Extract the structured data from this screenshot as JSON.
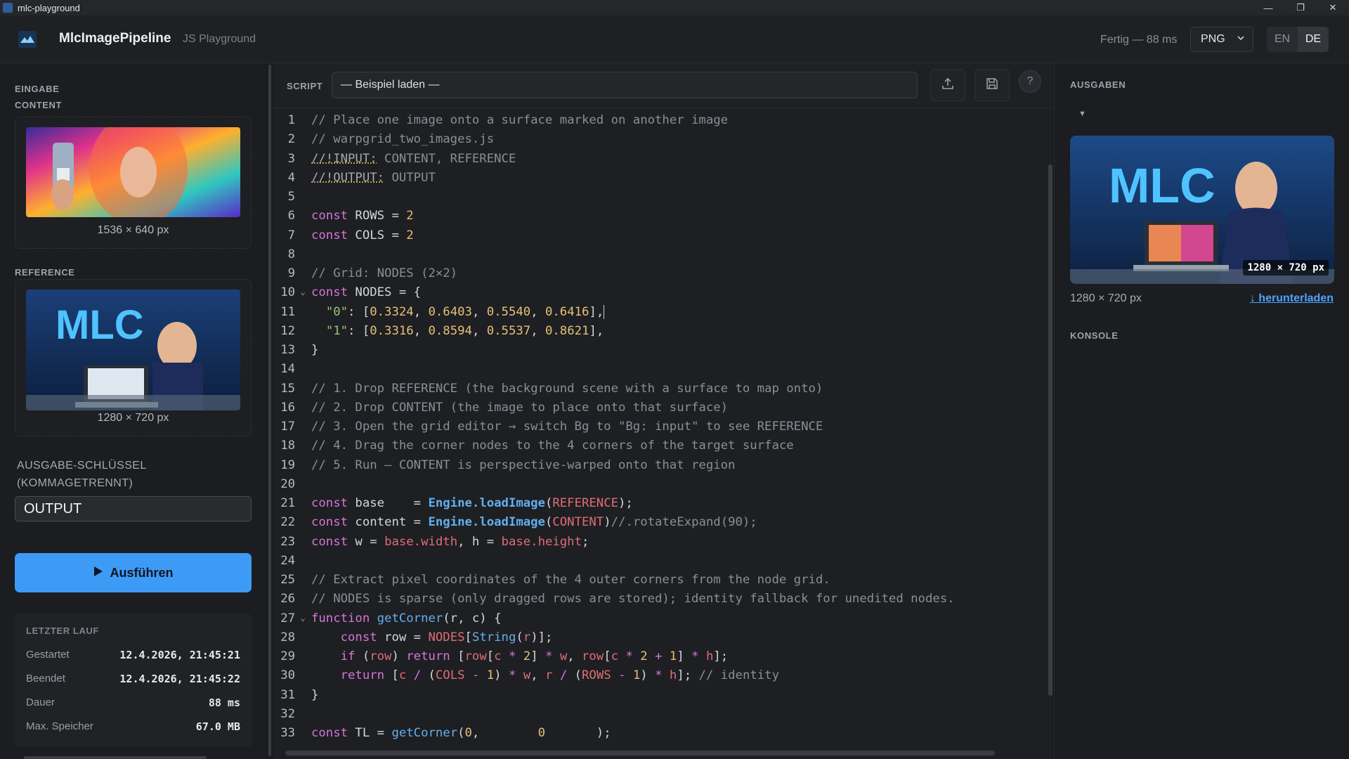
{
  "window": {
    "title": "mlc-playground",
    "controls": {
      "minimize": "—",
      "maximize": "❐",
      "close": "✕"
    }
  },
  "header": {
    "brand": "MlcImagePipeline",
    "subtitle": "JS Playground",
    "status": "Fertig — 88 ms",
    "format": "PNG",
    "languages": [
      "EN",
      "DE"
    ],
    "active_language": "DE"
  },
  "left": {
    "input_section": "EINGABE",
    "content_section": "CONTENT",
    "content_dim": "1536 × 640 px",
    "reference_section": "REFERENCE",
    "reference_dim": "1280 × 720 px",
    "output_key_label_1": "AUSGABE-SCHLÜSSEL",
    "output_key_label_2": "(KOMMAGETRENNT)",
    "output_key_value": "OUTPUT",
    "run_label": "Ausführen",
    "last_run": {
      "title": "LETZTER LAUF",
      "rows": [
        {
          "label": "Gestartet",
          "value": "12.4.2026, 21:45:21"
        },
        {
          "label": "Beendet",
          "value": "12.4.2026, 21:45:22"
        },
        {
          "label": "Dauer",
          "value": "88 ms"
        },
        {
          "label": "Max. Speicher",
          "value": "67.0 MB"
        }
      ]
    }
  },
  "editor": {
    "script_label": "SCRIPT",
    "example_placeholder": "— Beispiel laden —",
    "help": "?",
    "line_numbers": [
      "1",
      "2",
      "3",
      "4",
      "5",
      "6",
      "7",
      "8",
      "9",
      "10",
      "11",
      "12",
      "13",
      "14",
      "15",
      "16",
      "17",
      "18",
      "19",
      "20",
      "21",
      "22",
      "23",
      "24",
      "25",
      "26",
      "27",
      "28",
      "29",
      "30",
      "31",
      "32",
      "33"
    ],
    "code": {
      "l1": "// Place one image onto a surface marked on another image",
      "l2": "// warpgrid_two_images.js",
      "l3_dir": "//!INPUT:",
      "l3_rest": " CONTENT, REFERENCE",
      "l4_dir": "//!OUTPUT:",
      "l4_rest": " OUTPUT",
      "kw_const": "const",
      "kw_function": "function",
      "kw_if": "if",
      "kw_return": "return",
      "rows_name": " ROWS = ",
      "rows_val": "2",
      "cols_name": " COLS = ",
      "cols_val": "2",
      "l9": "// Grid: NODES (2×2)",
      "l10_rest": " NODES = {",
      "l11_key": "\"0\"",
      "l11_vals": [
        "0.3324",
        "0.6403",
        "0.5540",
        "0.6416"
      ],
      "l12_key": "\"1\"",
      "l12_vals": [
        "0.3316",
        "0.8594",
        "0.5537",
        "0.8621"
      ],
      "l13": "}",
      "l15": "// 1. Drop REFERENCE (the background scene with a surface to map onto)",
      "l16": "// 2. Drop CONTENT (the image to place onto that surface)",
      "l17": "// 3. Open the grid editor → switch Bg to \"Bg: input\" to see REFERENCE",
      "l18": "// 4. Drag the corner nodes to the 4 corners of the target surface",
      "l19": "// 5. Run — CONTENT is perspective-warped onto that region",
      "l21_var": " base    = ",
      "engine": "Engine",
      "load": ".loadImage",
      "reference": "REFERENCE",
      "content": "CONTENT",
      "l22_var": " content = ",
      "l22_comment": "//.rotateExpand(90);",
      "l23_w": " w = ",
      "base_width": "base.width",
      "l23_h": ", h = ",
      "base_height": "base.height",
      "l25": "// Extract pixel coordinates of the 4 outer corners from the node grid.",
      "l26": "// NODES is sparse (only dragged rows are stored); identity fallback for unedited nodes.",
      "getcorner": "getCorner",
      "l27_params": "(r, c) {",
      "l28_a": " row = ",
      "nodes": "NODES",
      "string": "String",
      "r": "r",
      "c_": "c",
      "w_": "w",
      "h_": "h",
      "rows_id": "ROWS",
      "cols_id": "COLS",
      "row_id": "row",
      "one": "1",
      "two": "2",
      "identity": "// identity",
      "l31": "}",
      "l33_a": " TL = ",
      "zero": "0"
    }
  },
  "right": {
    "outputs_section": "AUSGABEN",
    "badge": "1280 × 720 px",
    "dim": "1280 × 720 px",
    "download": "↓ herunterladen",
    "console_section": "KONSOLE",
    "mlc_text": "MLC"
  }
}
